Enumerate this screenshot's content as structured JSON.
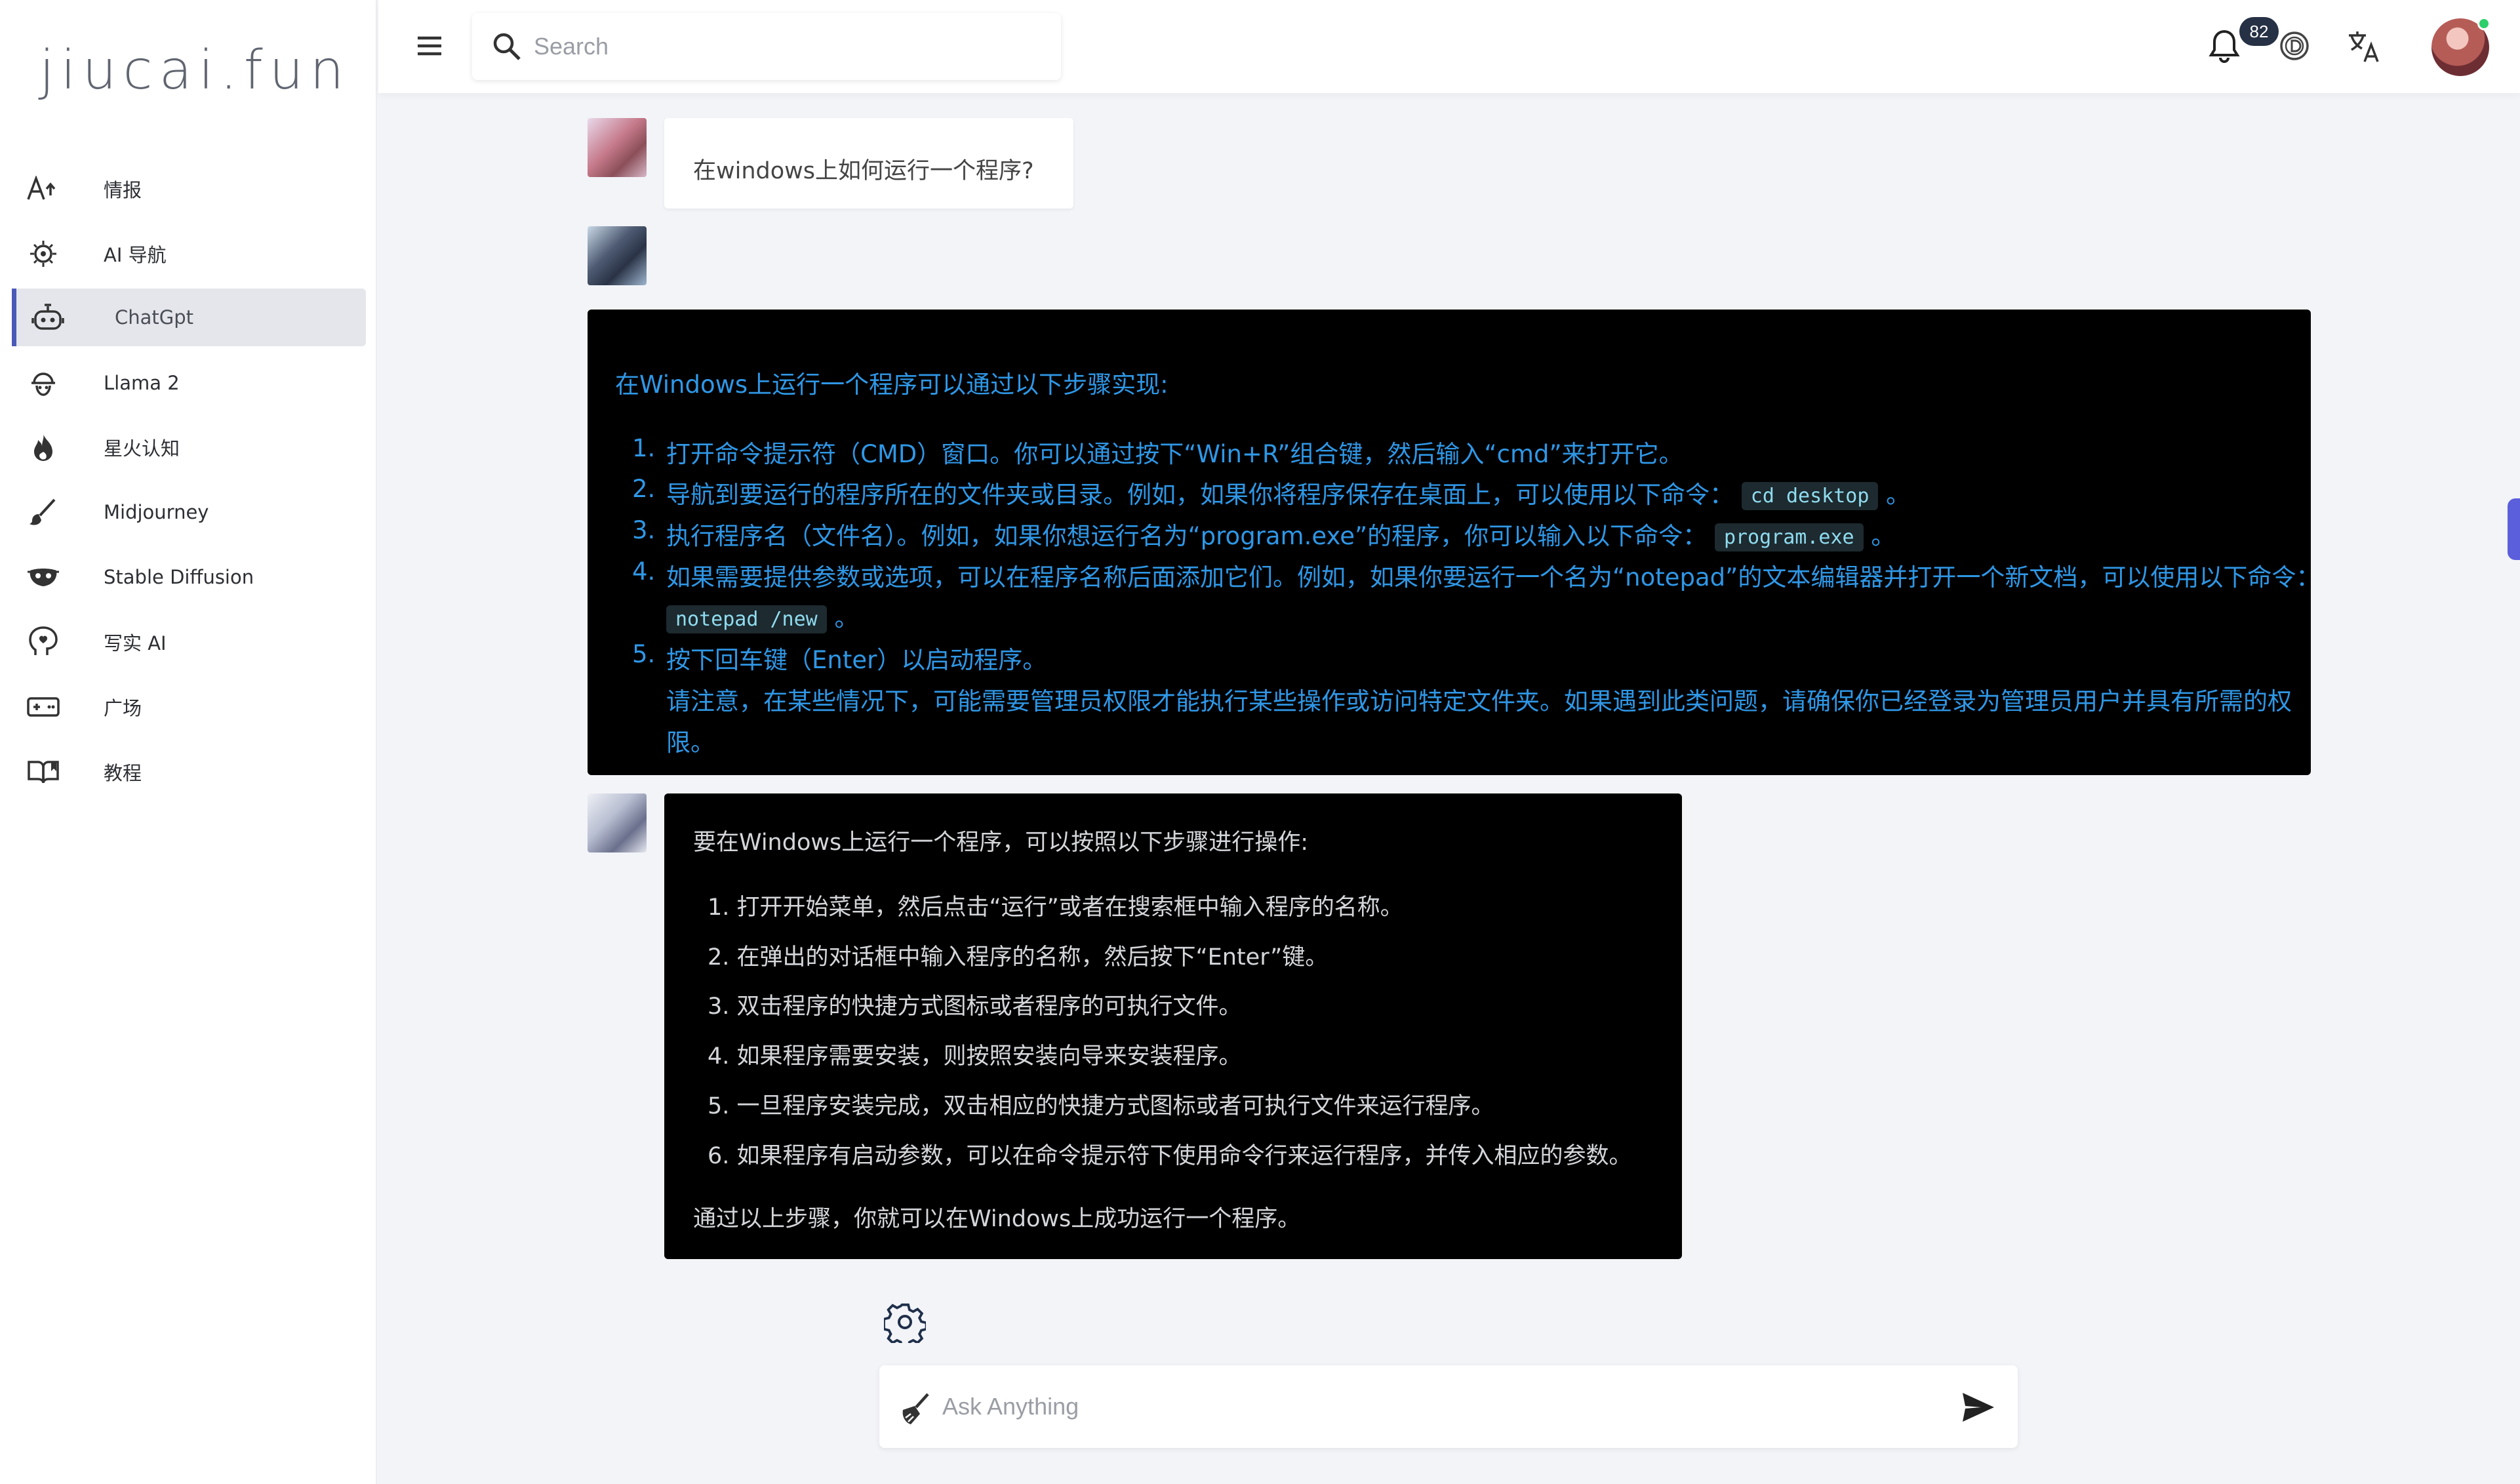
{
  "brand": {
    "logo_text": "jiucai.fun"
  },
  "sidebar": {
    "items": [
      {
        "label": "情报",
        "icon": "font-size-icon"
      },
      {
        "label": "AI 导航",
        "icon": "compass-icon"
      },
      {
        "label": "ChatGpt",
        "icon": "robot-icon",
        "active": true
      },
      {
        "label": "Llama 2",
        "icon": "llama-icon"
      },
      {
        "label": "星火认知",
        "icon": "fire-icon"
      },
      {
        "label": "Midjourney",
        "icon": "brush-icon"
      },
      {
        "label": "Stable Diffusion",
        "icon": "mask-icon"
      },
      {
        "label": "写实 AI",
        "icon": "head-icon"
      },
      {
        "label": "广场",
        "icon": "gamepad-icon"
      },
      {
        "label": "教程",
        "icon": "book-icon"
      }
    ]
  },
  "topbar": {
    "search_placeholder": "Search",
    "notification_count": "82"
  },
  "chat": {
    "user_question": "在windows上如何运行一个程序?",
    "answer1": {
      "intro": "在Windows上运行一个程序可以通过以下步骤实现:",
      "items": [
        {
          "num": "1.",
          "text": "打开命令提示符（CMD）窗口。你可以通过按下“Win+R”组合键，然后输入“cmd”来打开它。"
        },
        {
          "num": "2.",
          "text": "导航到要运行的程序所在的文件夹或目录。例如，如果你将程序保存在桌面上，可以使用以下命令：",
          "code": "cd desktop",
          "after": "。"
        },
        {
          "num": "3.",
          "text": "执行程序名（文件名）。例如，如果你想运行名为“program.exe”的程序，你可以输入以下命令：",
          "code": "program.exe",
          "after": "。"
        },
        {
          "num": "4.",
          "text": "如果需要提供参数或选项，可以在程序名称后面添加它们。例如，如果你要运行一个名为“notepad”的文本编辑器并打开一个新文档，可以使用以下命令：",
          "code": "notepad /new",
          "after": "。"
        },
        {
          "num": "5.",
          "text": "按下回车键（Enter）以启动程序。"
        }
      ],
      "note_line1": "请注意，在某些情况下，可能需要管理员权限才能执行某些操作或访问特定文件夹。如果遇到此类问题，请确保你已经登录为管理员用户并具有所需的权",
      "note_line2": "限。"
    },
    "answer2": {
      "intro": "要在Windows上运行一个程序，可以按照以下步骤进行操作:",
      "items": [
        "1. 打开开始菜单，然后点击“运行”或者在搜索框中输入程序的名称。",
        "2. 在弹出的对话框中输入程序的名称，然后按下“Enter”键。",
        "3. 双击程序的快捷方式图标或者程序的可执行文件。",
        "4. 如果程序需要安装，则按照安装向导来安装程序。",
        "5. 一旦程序安装完成，双击相应的快捷方式图标或者可执行文件来运行程序。",
        "6. 如果程序有启动参数，可以在命令提示符下使用命令行来运行程序，并传入相应的参数。"
      ],
      "outro": "通过以上步骤，你就可以在Windows上成功运行一个程序。"
    }
  },
  "composer": {
    "placeholder": "Ask Anything"
  },
  "colors": {
    "accent": "#4b5ab8",
    "answer_blue": "#2f97e6",
    "badge_bg": "#263145",
    "online": "#2ecf6a"
  }
}
